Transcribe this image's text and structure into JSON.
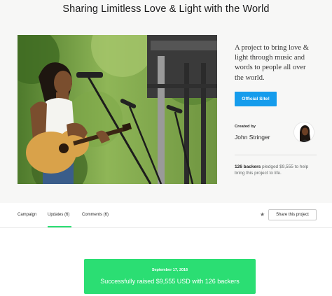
{
  "project": {
    "title": "Sharing Limitless Love & Light with the World",
    "blurb": "A project to bring love & light through music and words to people all over the world.",
    "official_site_label": "Official Site!"
  },
  "creator": {
    "created_by_label": "Created by",
    "name": "John Stringer"
  },
  "stats": {
    "backers": "126 backers",
    "rest": " pledged $9,555 to help bring this project to life."
  },
  "tabs": [
    {
      "label": "Campaign",
      "active": false
    },
    {
      "label": "Updates (6)",
      "active": true
    },
    {
      "label": "Comments (6)",
      "active": false
    }
  ],
  "share_label": "Share this project",
  "banner": {
    "date": "September 17, 2016",
    "message": "Successfully raised $9,555 USD with 126 backers"
  },
  "colors": {
    "accent_green": "#2bde73",
    "button_blue": "#159cec",
    "hero_background": "#f7f7f6"
  }
}
